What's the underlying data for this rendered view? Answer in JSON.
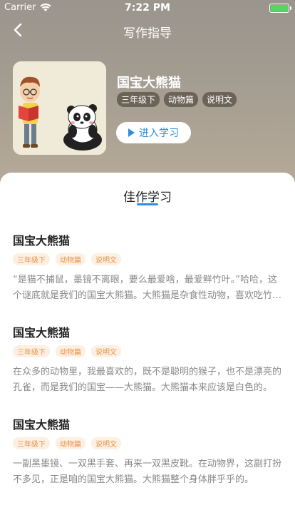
{
  "status_bar": {
    "carrier": "Carrier",
    "time": "7:22 PM"
  },
  "nav": {
    "title": "写作指导"
  },
  "book": {
    "title": "国宝大熊猫",
    "tags": [
      "三年级下",
      "动物篇",
      "说明文"
    ],
    "enter_label": "进入学习"
  },
  "section": {
    "title": "佳作学习"
  },
  "articles": [
    {
      "title": "国宝大熊猫",
      "tags": [
        "三年级下",
        "动物篇",
        "说明文"
      ],
      "excerpt": "“是猫不捕鼠，墨镜不离眼，要么最爱啥，最爱鲜竹叶。”哈哈，这个谜底就是我们的国宝大熊猫。大熊猫是杂食性动物，喜欢吃竹子。"
    },
    {
      "title": "国宝大熊猫",
      "tags": [
        "三年级下",
        "动物篇",
        "说明文"
      ],
      "excerpt": "在众多的动物里，我最喜欢的，既不是聪明的猴子，也不是漂亮的孔雀，而是我们的国宝——大熊猫。大熊猫本来应该是白色的。"
    },
    {
      "title": "国宝大熊猫",
      "tags": [
        "三年级下",
        "动物篇",
        "说明文"
      ],
      "excerpt": "一副黑墨镜、一双黑手套、再来一双黑皮靴。在动物界，这副打扮不多见，正是咱的国宝大熊猫。大熊猫整个身体胖乎乎的。"
    }
  ],
  "colors": {
    "accent": "#2e8fe0",
    "tag_text": "#e8934a",
    "tag_bg": "#fdf0e3"
  }
}
